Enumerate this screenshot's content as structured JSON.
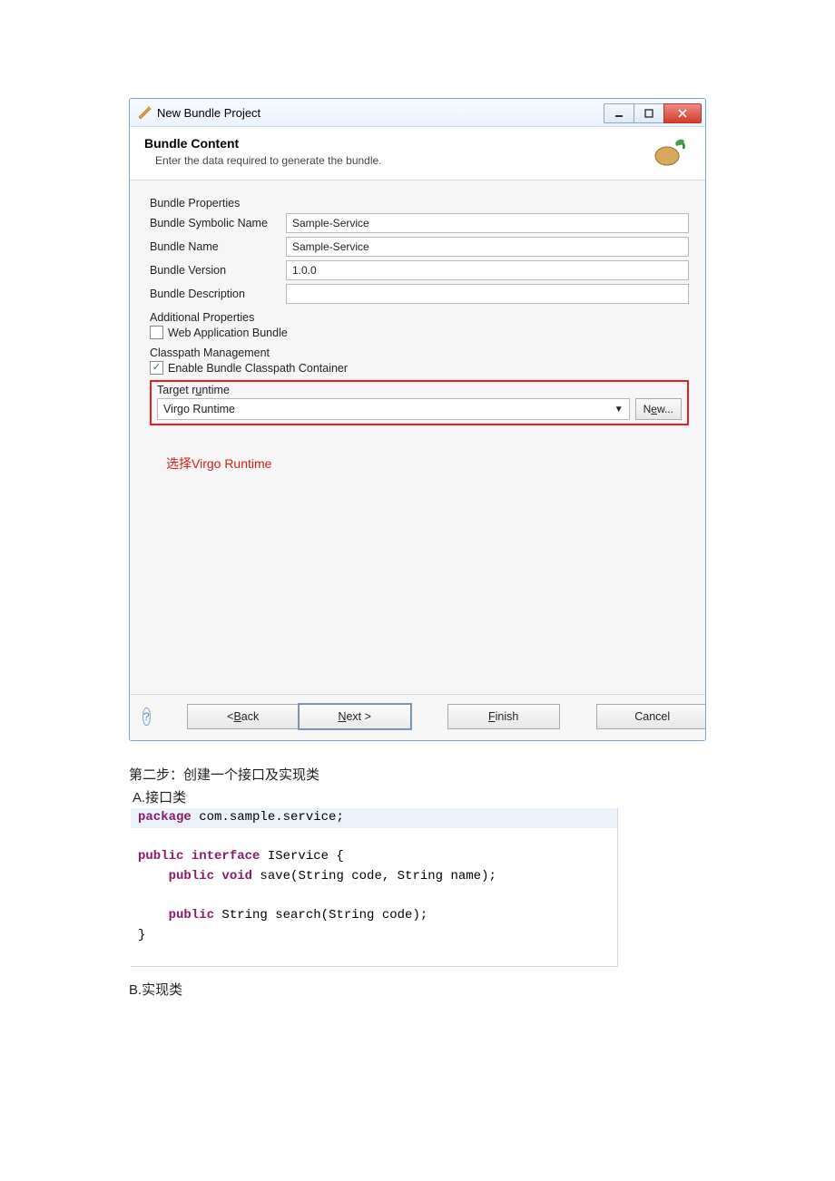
{
  "dialog": {
    "title": "New Bundle Project",
    "banner_title": "Bundle Content",
    "banner_desc": "Enter the data required to generate the bundle.",
    "props_heading": "Bundle Properties",
    "labels": {
      "symbolic": "Bundle Symbolic Name",
      "name": "Bundle Name",
      "version": "Bundle Version",
      "description": "Bundle Description"
    },
    "values": {
      "symbolic": "Sample-Service",
      "name": "Sample-Service",
      "version": "1.0.0",
      "description": ""
    },
    "additional_heading": "Additional Properties",
    "wab_label": "Web Application Bundle",
    "wab_checked": false,
    "classpath_heading": "Classpath Management",
    "classpath_label": "Enable Bundle Classpath Container",
    "classpath_checked": true,
    "runtime_heading": "Target runtime",
    "runtime_value": "Virgo Runtime",
    "new_btn": "New...",
    "red_note": "选择Virgo Runtime",
    "buttons": {
      "back": "< Back",
      "next": "Next >",
      "finish": "Finish",
      "cancel": "Cancel"
    }
  },
  "doc": {
    "step2": "第二步：创建一个接口及实现类",
    "a_label": " A.接口类",
    "b_label": "B.实现类"
  },
  "code": {
    "l1a": "package",
    "l1b": " com.sample.service;",
    "l3a": "public interface",
    "l3b": " IService {",
    "l4a": "    public void",
    "l4b": " save(String code, String name);",
    "l6a": "    public",
    "l6b": " String search(String code);",
    "l7": "}"
  }
}
